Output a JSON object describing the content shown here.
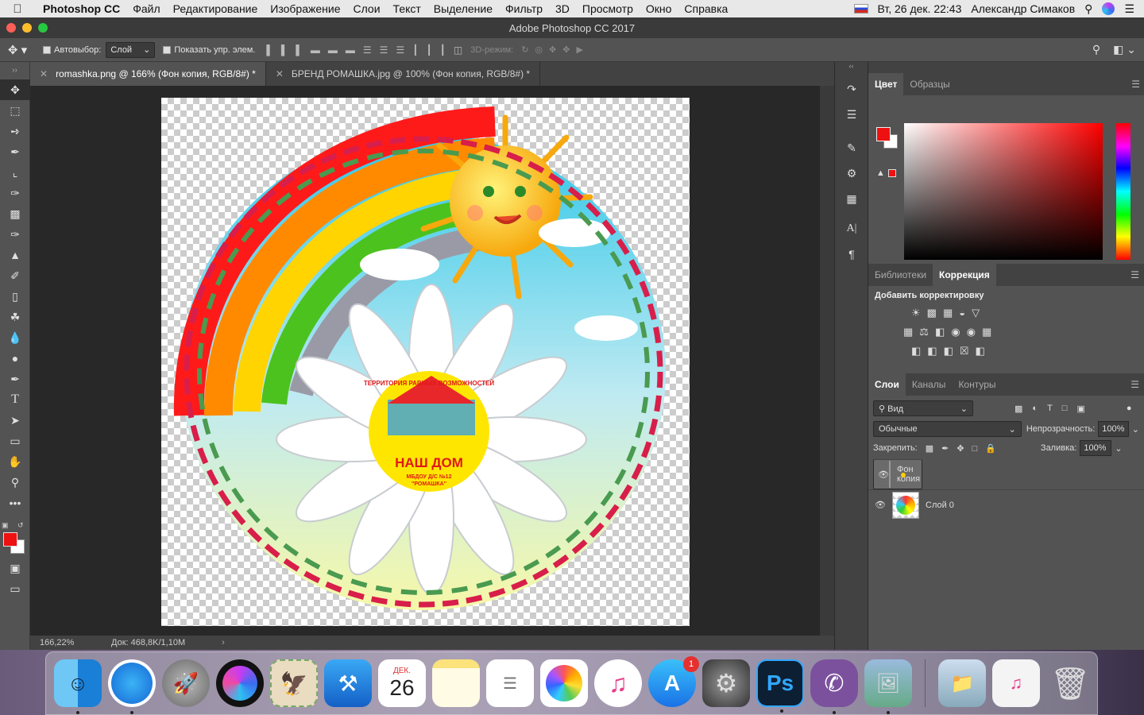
{
  "menubar": {
    "app": "Photoshop CC",
    "items": [
      "Файл",
      "Редактирование",
      "Изображение",
      "Слои",
      "Текст",
      "Выделение",
      "Фильтр",
      "3D",
      "Просмотр",
      "Окно",
      "Справка"
    ],
    "datetime": "Вт, 26 дек. 22:43",
    "user": "Александр Симаков"
  },
  "window": {
    "title": "Adobe Photoshop CC 2017"
  },
  "options": {
    "autoselect_label": "Автовыбор:",
    "autoselect_value": "Слой",
    "show_controls_label": "Показать упр. элем.",
    "mode3d_label": "3D-режим:"
  },
  "tabs": [
    {
      "label": "romashka.png @ 166% (Фон копия, RGB/8#) *"
    },
    {
      "label": "БРЕНД РОМАШКА.jpg @ 100% (Фон копия, RGB/8#) *"
    }
  ],
  "status": {
    "zoom": "166,22%",
    "doc": "Док: 468,8K/1,10M"
  },
  "color_panel": {
    "tabs": [
      "Цвет",
      "Образцы"
    ],
    "foreground": "#ee1111",
    "background": "#ffffff"
  },
  "adj_panel": {
    "tabs": [
      "Библиотеки",
      "Коррекция"
    ],
    "title": "Добавить корректировку"
  },
  "layers_panel": {
    "tabs": [
      "Слои",
      "Каналы",
      "Контуры"
    ],
    "filter": "Вид",
    "blend": "Обычные",
    "opacity_label": "Непрозрачность:",
    "opacity": "100%",
    "lock_label": "Закрепить:",
    "fill_label": "Заливка:",
    "fill": "100%",
    "layers": [
      {
        "name": "Фон копия"
      },
      {
        "name": "Слой 0"
      }
    ]
  },
  "artwork": {
    "badge_top": "ТЕРРИТОРИЯ РАВНЫХ ВОЗМОЖНОСТЕЙ",
    "badge_main": "НАШ ДОМ",
    "badge_sub": "МБДОУ Д/С №12",
    "badge_sub2": "\"РОМАШКА\""
  },
  "dock": {
    "calendar_month": "ДЕК.",
    "calendar_day": "26",
    "appstore_badge": "1",
    "ps_label": "Ps"
  }
}
